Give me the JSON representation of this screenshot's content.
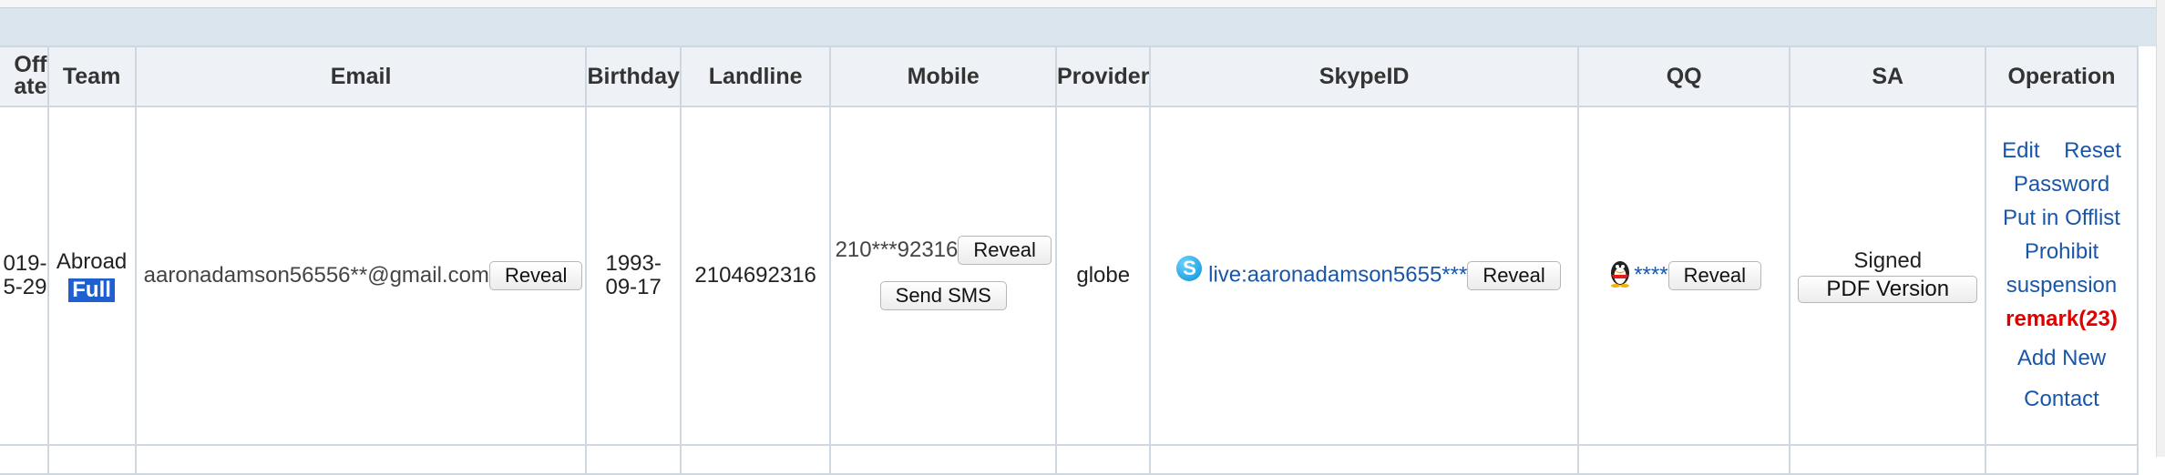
{
  "columns": {
    "offdate": "Off\nate",
    "team": "Team",
    "email": "Email",
    "birthday": "Birthday",
    "landline": "Landline",
    "mobile": "Mobile",
    "provider": "Provider",
    "skype": "SkypeID",
    "qq": "QQ",
    "sa": "SA",
    "operation": "Operation"
  },
  "row": {
    "offdate_line1": "019-",
    "offdate_line2": "5-29",
    "team_name": "Abroad",
    "team_badge": "Full",
    "email": "aaronadamson56556**@gmail.com",
    "birthday_line1": "1993-",
    "birthday_line2": "09-17",
    "landline": "2104692316",
    "mobile": "210***92316",
    "provider": "globe",
    "skype": "live:aaronadamson5655***",
    "qq": "****",
    "sa_status": "Signed",
    "sa_pdf": "PDF Version"
  },
  "buttons": {
    "reveal": "Reveal",
    "send_sms": "Send SMS"
  },
  "operation": {
    "edit": "Edit",
    "reset": "Reset",
    "password": "Password",
    "offlist": "Put in Offlist",
    "prohibit": "Prohibit",
    "suspension": "suspension",
    "remark": "remark(23)",
    "add_new": "Add New",
    "contact": "Contact"
  },
  "colors": {
    "header_band": "#dbe5ee",
    "link": "#1a56a8",
    "remark": "#e00000",
    "badge": "#1f5fd0"
  },
  "icons": [
    "skype-icon",
    "qq-penguin-icon"
  ]
}
